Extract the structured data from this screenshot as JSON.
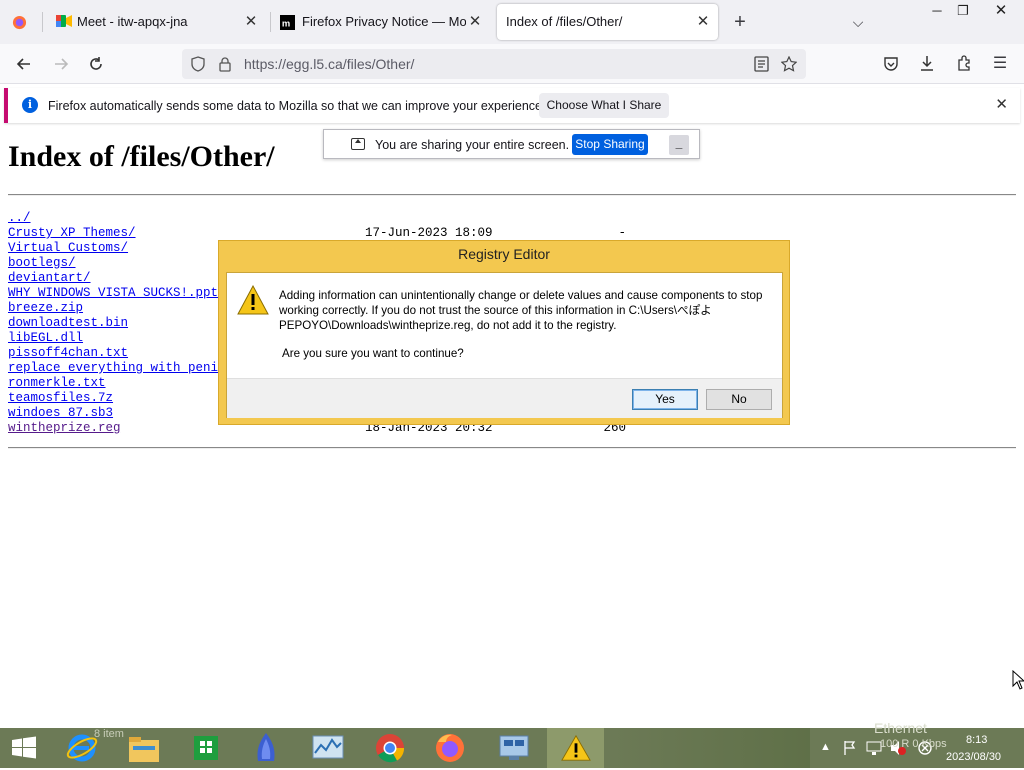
{
  "tabs": [
    {
      "title": "",
      "icon": "firefox-view-icon"
    },
    {
      "title": "Meet - itw-apqx-jna",
      "icon": "google-meet-icon"
    },
    {
      "title": "Firefox Privacy Notice — Mozill",
      "icon": "mozilla-icon"
    },
    {
      "title": "Index of /files/Other/",
      "icon": ""
    }
  ],
  "url": "https://egg.l5.ca/files/Other/",
  "notification": {
    "message": "Firefox automatically sends some data to Mozilla so that we can improve your experience.",
    "button": "Choose What I Share"
  },
  "share_bar": {
    "message": "You are sharing your entire screen.",
    "stop_label": "Stop Sharing",
    "minimize": "_"
  },
  "page": {
    "heading": "Index of /files/Other/",
    "entries": [
      {
        "name": "../",
        "date": "",
        "size": ""
      },
      {
        "name": "Crusty XP Themes/",
        "date": "17-Jun-2023 18:09",
        "size": "-"
      },
      {
        "name": "Virtual Customs/",
        "date": "",
        "size": ""
      },
      {
        "name": "bootlegs/",
        "date": "",
        "size": ""
      },
      {
        "name": "deviantart/",
        "date": "",
        "size": ""
      },
      {
        "name": "WHY WINDOWS VISTA SUCKS!.pptx",
        "date": "",
        "size": ""
      },
      {
        "name": "breeze.zip",
        "date": "",
        "size": ""
      },
      {
        "name": "downloadtest.bin",
        "date": "",
        "size": ""
      },
      {
        "name": "libEGL.dll",
        "date": "",
        "size": ""
      },
      {
        "name": "pissoff4chan.txt",
        "date": "",
        "size": ""
      },
      {
        "name": "replace everything with penis.",
        "date": "",
        "size": ""
      },
      {
        "name": "ronmerkle.txt",
        "date": "",
        "size": ""
      },
      {
        "name": "teamosfiles.7z",
        "date": "",
        "size": ""
      },
      {
        "name": "windoes 87.sb3",
        "date": "",
        "size": ""
      },
      {
        "name": "wintheprize.reg",
        "date": "18-Jan-2023 20:32",
        "size": "260"
      }
    ]
  },
  "dialog": {
    "title": "Registry Editor",
    "message": "Adding information can unintentionally change or delete values and cause components to stop working correctly. If you do not trust the source of this information in C:\\Users\\ぺぽよPEPOYO\\Downloads\\wintheprize.reg, do not add it to the registry.",
    "question": "Are you sure you want to continue?",
    "yes": "Yes",
    "no": "No"
  },
  "taskbar": {
    "items": [
      "internet-explorer-icon",
      "file-explorer-icon",
      "store-icon",
      "app-icon",
      "task-manager-icon",
      "chrome-icon",
      "firefox-icon",
      "network-app-icon",
      "registry-warning-icon"
    ],
    "ghost_label": "8 item",
    "network_label": "Ethernet",
    "rate_label": "100 R  0 Kbps",
    "time": "8:13",
    "date": "2023/08/30"
  }
}
